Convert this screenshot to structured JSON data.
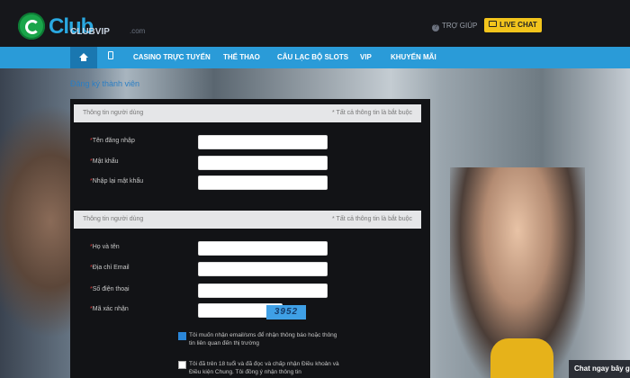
{
  "brand": {
    "logo_text": "Club",
    "logo_small": "CLUBVIP",
    "logo_com": ".com"
  },
  "header": {
    "help_label": "TRỢ GIÚP",
    "live_chat_label": "LIVE CHAT"
  },
  "nav": {
    "items": [
      "CASINO TRỰC TUYẾN",
      "THỂ THAO",
      "CÂU LẠC BỘ SLOTS",
      "VIP",
      "KHUYẾN MÃI"
    ]
  },
  "breadcrumb": "Đăng ký thành viên",
  "section1": {
    "title": "Thông tin người dùng",
    "note": "* Tất cả thông tin là bắt buộc",
    "fields": [
      "Tên đăng nhập",
      "Mật khẩu",
      "Nhập lại mật khẩu"
    ]
  },
  "section2": {
    "title": "Thông tin người dùng",
    "note": "* Tất cả thông tin là bắt buộc",
    "fields": [
      "Họ và tên",
      "Địa chỉ Email",
      "Số điện thoại",
      "Mã xác nhận"
    ]
  },
  "captcha_text": "3952",
  "checkboxes": [
    {
      "text": "Tôi muốn nhận email/sms để nhận thông báo hoặc thông tin liên quan đến thị trường",
      "checked": true
    },
    {
      "text": "Tôi đã trên 18 tuổi và đã đọc và chấp nhận Điều khoản và Điều kiện Chung. Tôi đồng ý nhận thông tin",
      "checked": false
    }
  ],
  "chat_now_label": "Chat ngay bây g",
  "colors": {
    "nav": "#2a9bd8",
    "live_chat": "#f2c41c",
    "required_star": "#d43a3a"
  }
}
